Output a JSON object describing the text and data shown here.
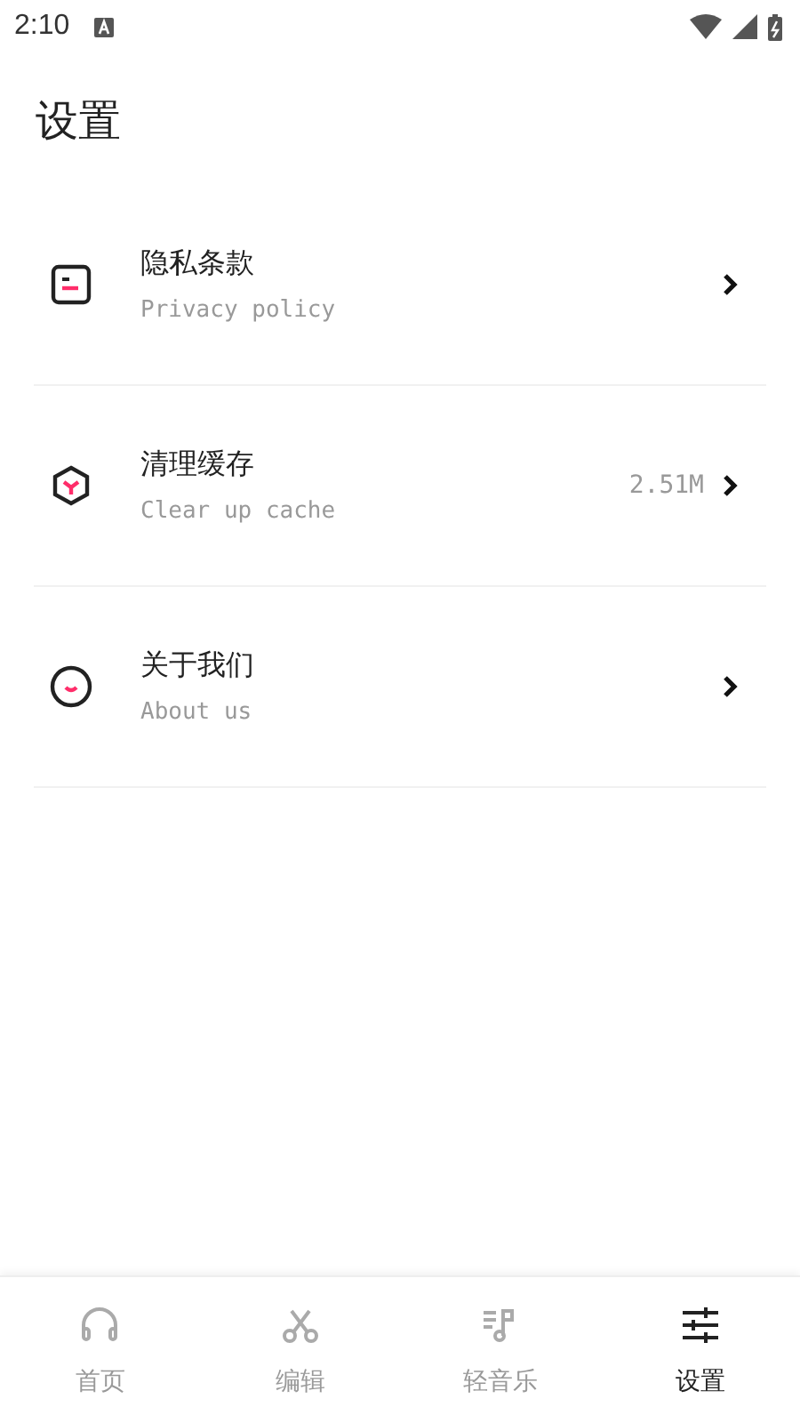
{
  "status_bar": {
    "time": "2:10"
  },
  "title": "设置",
  "items": [
    {
      "kind": "document",
      "title": "隐私条款",
      "subtitle": "Privacy policy"
    },
    {
      "kind": "hexagon",
      "title": "清理缓存",
      "subtitle": "Clear up cache",
      "value": "2.51M"
    },
    {
      "kind": "smile",
      "title": "关于我们",
      "subtitle": "About us"
    }
  ],
  "nav": [
    {
      "kind": "headphones",
      "label": "首页",
      "selected": false
    },
    {
      "kind": "scissors",
      "label": "编辑",
      "selected": false
    },
    {
      "kind": "music",
      "label": "轻音乐",
      "selected": false
    },
    {
      "kind": "sliders",
      "label": "设置",
      "selected": true
    }
  ]
}
